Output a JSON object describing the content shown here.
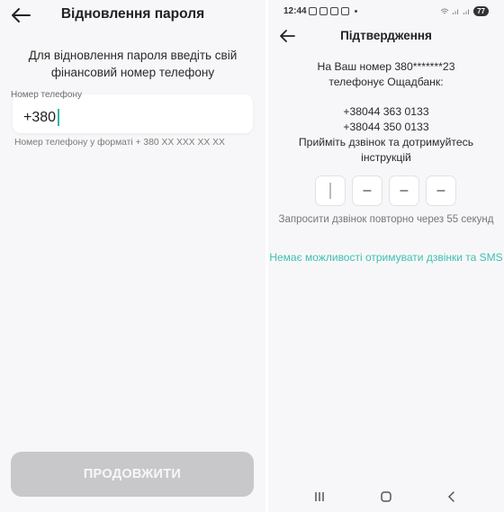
{
  "left_screen": {
    "title": "Відновлення пароля",
    "description": "Для відновлення пароля введіть свій фінансовий номер телефону",
    "phone_field": {
      "label": "Номер телефону",
      "value": "+380"
    },
    "hint": "Номер телефону у форматі + 380 XX XXX XX XX",
    "continue_label": "ПРОДОВЖИТИ"
  },
  "right_screen": {
    "status_bar": {
      "time": "12:44",
      "battery": "77"
    },
    "title": "Підтвердження",
    "call_line1": "На Ваш номер 380*******23",
    "call_line2": "телефонує Ощадбанк:",
    "number1": "+38044 363 0133",
    "number2": "+38044 350 0133",
    "instruction_line1": "Прийміть дзвінок та дотримуйтесь",
    "instruction_line2": "інструкцій",
    "code_digits": [
      "",
      "–",
      "–",
      "–"
    ],
    "resend_text": "Запросити дзвінок повторно через 55 секунд",
    "no_calls_link": "Немає можливості отримувати дзвінки та SMS"
  },
  "colors": {
    "accent": "#3fbfae",
    "disabled_button": "#c8c8ca",
    "background": "#f7f7f9"
  },
  "icons": [
    "back-arrow-icon",
    "recent-apps-icon",
    "home-icon",
    "back-nav-icon"
  ]
}
